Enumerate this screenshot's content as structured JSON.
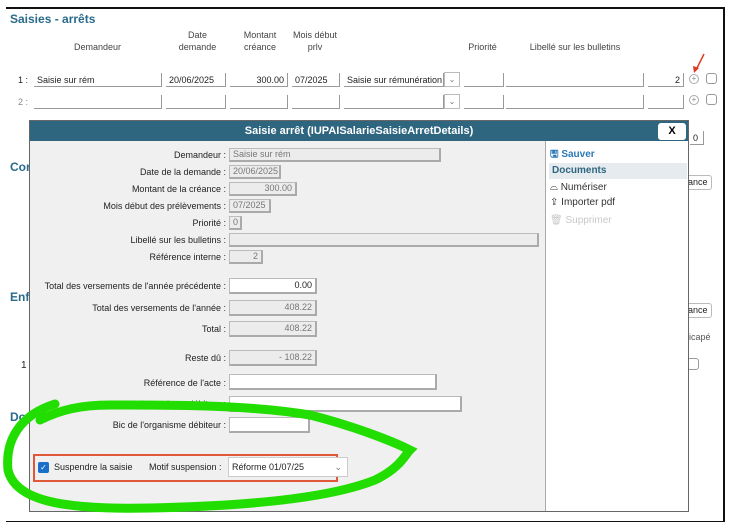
{
  "section_title": "Saisies - arrêts",
  "columns": [
    "Demandeur",
    "Date demande",
    "Montant créance",
    "Mois début prlv",
    "Priorité",
    "Libellé sur les bulletins"
  ],
  "rows": [
    {
      "num": "1 :",
      "demandeur": "Saisie sur rém",
      "date": "20/06/2025",
      "montant": "300.00",
      "mois": "07/2025",
      "type": "Saisie sur rémunération",
      "priorite": "",
      "libelle": "",
      "ref": "2"
    },
    {
      "num": "2 :",
      "demandeur": "",
      "date": "",
      "montant": "",
      "mois": "",
      "type": "",
      "priorite": "",
      "libelle": "",
      "ref": ""
    }
  ],
  "background": {
    "sec2": "Cor",
    "sec3": "Enf",
    "sec4": "Don",
    "row_num": "1",
    "btn1": "ance",
    "btn2": "ance",
    "handicap": "dicapé",
    "zero": "0"
  },
  "dialog": {
    "title": "Saisie arrêt (IUPAISalarieSaisieArretDetails)",
    "close": "X",
    "fields": [
      {
        "label": "Demandeur :",
        "value": "Saisie sur rém"
      },
      {
        "label": "Date de la demande :",
        "value": "20/06/2025"
      },
      {
        "label": "Montant de la créance :",
        "value": "300.00"
      },
      {
        "label": "Mois début des prélèvements :",
        "value": "07/2025"
      },
      {
        "label": "Priorité :",
        "value": "0"
      },
      {
        "label": "Libellé sur les bulletins :",
        "value": ""
      },
      {
        "label": "Référence interne :",
        "value": "2"
      }
    ],
    "totals": [
      {
        "label": "Total des versements de l'année précédente :",
        "value": "0.00"
      },
      {
        "label": "Total des versements de l'année :",
        "value": "408.22"
      },
      {
        "label": "Total :",
        "value": "408.22"
      },
      {
        "label": "Reste dû :",
        "value": "- 108.22"
      }
    ],
    "bank": [
      {
        "label": "Référence de l'acte :",
        "value": ""
      },
      {
        "label": "Iban de l'organisme débiteur :",
        "value": ""
      },
      {
        "label": "Bic de l'organisme débiteur :",
        "value": ""
      }
    ],
    "suspend_label": "Suspendre la saisie",
    "suspend_checked": true,
    "motif_label": "Motif suspension :",
    "motif_value": "Réforme 01/07/25",
    "side": {
      "save": "Sauver",
      "documents": "Documents",
      "scan": "Numériser",
      "import": "Importer pdf",
      "delete": "Supprimer"
    }
  },
  "colors": {
    "accent": "#2e6680",
    "highlight": "#e0573a",
    "annotation": "#22dd00"
  }
}
